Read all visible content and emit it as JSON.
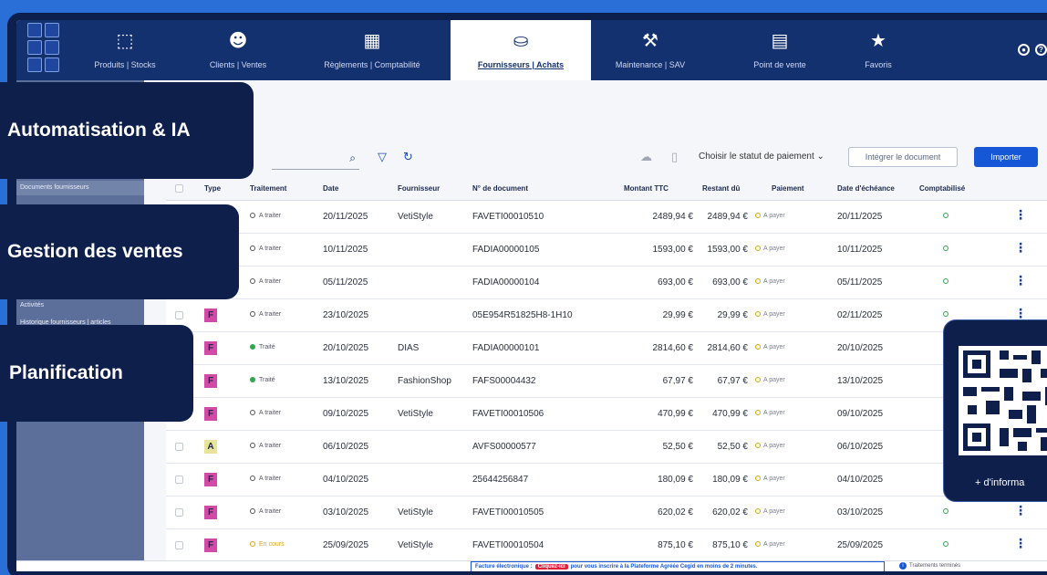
{
  "nav": {
    "items": [
      {
        "label": "Produits | Stocks",
        "icon": "boxes-icon"
      },
      {
        "label": "Clients | Ventes",
        "icon": "users-icon"
      },
      {
        "label": "Règlements | Comptabilité",
        "icon": "calculator-icon"
      },
      {
        "label": "Fournisseurs | Achats",
        "icon": "basket-icon",
        "active": true
      },
      {
        "label": "Maintenance | SAV",
        "icon": "wrench-icon"
      },
      {
        "label": "Point de vente",
        "icon": "store-icon"
      },
      {
        "label": "Favoris",
        "icon": "star-icon"
      }
    ]
  },
  "sidebar": {
    "items": [
      "Documents fournisseurs",
      "Activités",
      "Historique fournisseurs | articles"
    ]
  },
  "toolbar": {
    "status_select": "Choisir le statut de paiement",
    "integrer_label": "Intégrer le document",
    "importer_label": "Importer"
  },
  "table": {
    "headers": [
      "Type",
      "Traitement",
      "Date",
      "Fournisseur",
      "N° de document",
      "Montant TTC",
      "Restant dû",
      "Paiement",
      "Date d'échéance",
      "Comptabilisé"
    ],
    "rows": [
      {
        "type": "",
        "traitement": "A traiter",
        "status": "todo",
        "date": "20/11/2025",
        "fournisseur": "VetiStyle",
        "doc": "FAVETI00010510",
        "montant": "2489,94 €",
        "restant": "2489,94 €",
        "paiement": "A payer",
        "echeance": "20/11/2025"
      },
      {
        "type": "",
        "traitement": "A traiter",
        "status": "todo",
        "date": "10/11/2025",
        "fournisseur": "",
        "doc": "FADIA00000105",
        "montant": "1593,00 €",
        "restant": "1593,00 €",
        "paiement": "A payer",
        "echeance": "10/11/2025"
      },
      {
        "type": "",
        "traitement": "A traiter",
        "status": "todo",
        "date": "05/11/2025",
        "fournisseur": "",
        "doc": "FADIA00000104",
        "montant": "693,00 €",
        "restant": "693,00 €",
        "paiement": "A payer",
        "echeance": "05/11/2025"
      },
      {
        "type": "F",
        "traitement": "A traiter",
        "status": "todo",
        "date": "23/10/2025",
        "fournisseur": "",
        "doc": "05E954R51825H8-1H10",
        "montant": "29,99 €",
        "restant": "29,99 €",
        "paiement": "A payer",
        "echeance": "02/11/2025"
      },
      {
        "type": "F",
        "traitement": "Traité",
        "status": "done",
        "date": "20/10/2025",
        "fournisseur": "DIAS",
        "doc": "FADIA00000101",
        "montant": "2814,60 €",
        "restant": "2814,60 €",
        "paiement": "A payer",
        "echeance": "20/10/2025"
      },
      {
        "type": "F",
        "traitement": "Traité",
        "status": "done",
        "date": "13/10/2025",
        "fournisseur": "FashionShop",
        "doc": "FAFS00004432",
        "montant": "67,97 €",
        "restant": "67,97 €",
        "paiement": "A payer",
        "echeance": "13/10/2025"
      },
      {
        "type": "F",
        "traitement": "A traiter",
        "status": "todo",
        "date": "09/10/2025",
        "fournisseur": "VetiStyle",
        "doc": "FAVETI00010506",
        "montant": "470,99 €",
        "restant": "470,99 €",
        "paiement": "A payer",
        "echeance": "09/10/2025"
      },
      {
        "type": "A",
        "traitement": "A traiter",
        "status": "todo",
        "date": "06/10/2025",
        "fournisseur": "",
        "doc": "AVFS00000577",
        "montant": "52,50 €",
        "restant": "52,50 €",
        "paiement": "A payer",
        "echeance": "06/10/2025"
      },
      {
        "type": "F",
        "traitement": "A traiter",
        "status": "todo",
        "date": "04/10/2025",
        "fournisseur": "",
        "doc": "25644256847",
        "montant": "180,09 €",
        "restant": "180,09 €",
        "paiement": "A payer",
        "echeance": "04/10/2025"
      },
      {
        "type": "F",
        "traitement": "A traiter",
        "status": "todo",
        "date": "03/10/2025",
        "fournisseur": "VetiStyle",
        "doc": "FAVETI00010505",
        "montant": "620,02 €",
        "restant": "620,02 €",
        "paiement": "A payer",
        "echeance": "03/10/2025"
      },
      {
        "type": "F",
        "traitement": "En cours",
        "status": "progress",
        "date": "25/09/2025",
        "fournisseur": "VetiStyle",
        "doc": "FAVETI00010504",
        "montant": "875,10 €",
        "restant": "875,10 €",
        "paiement": "A payer",
        "echeance": "25/09/2025"
      }
    ]
  },
  "footer": {
    "banner_prefix": "Facture électronique :",
    "banner_cta": "Cliquez-ici",
    "banner_suffix": "pour vous inscrire à la Plateforme Agréée Cegid en moins de 2 minutes.",
    "note": "Traitements terminés"
  },
  "overlays": {
    "badges": [
      "Automatisation & IA",
      "Gestion des ventes",
      "Planification"
    ],
    "qr_label": "+ d'informa"
  },
  "colors": {
    "nav_bg": "#14316f",
    "accent": "#1557d6",
    "type_F": "#d14aa6",
    "type_A": "#e8e39a",
    "done": "#2ea84a",
    "todo": "#555555",
    "progress": "#e2a200"
  }
}
